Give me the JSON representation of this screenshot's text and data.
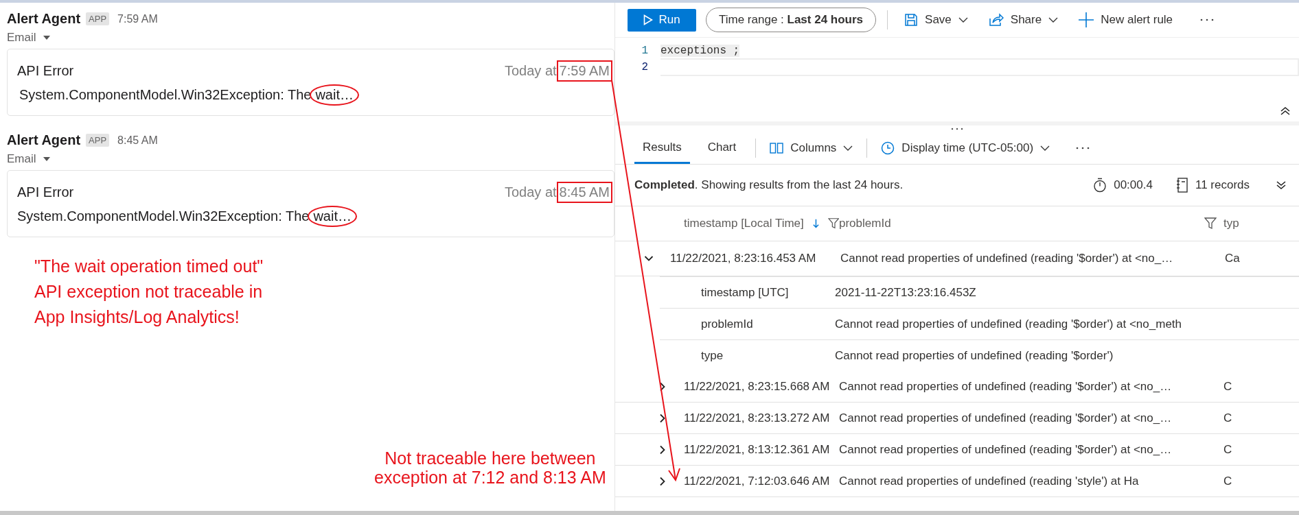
{
  "messages": [
    {
      "sender": "Alert Agent",
      "badge": "APP",
      "time": "7:59 AM",
      "channel": "Email",
      "card": {
        "title": "API Error",
        "prefix": "Today at",
        "time": "7:59 AM",
        "message": "System.ComponentModel.Win32Exception: The",
        "highlight": "wait…"
      }
    },
    {
      "sender": "Alert Agent",
      "badge": "APP",
      "time": "8:45 AM",
      "channel": "Email",
      "card": {
        "title": "API Error",
        "prefix": "Today at",
        "time": "8:45 AM",
        "message": "System.ComponentModel.Win32Exception: The",
        "highlight": "wait…"
      }
    }
  ],
  "annotation": "\"The wait operation timed out\" API exception not traceable in App Insights/Log Analytics!",
  "bottom_annotation": [
    "Not traceable here between",
    "exception at 7:12 and 8:13 AM"
  ],
  "toolbar": {
    "run": "Run",
    "time_range_label": "Time range :",
    "time_range_value": "Last 24 hours",
    "save": "Save",
    "share": "Share",
    "new_alert_rule": "New alert rule"
  },
  "editor": [
    {
      "number": "1",
      "code": "exceptions ;"
    },
    {
      "number": "2"
    }
  ],
  "tabs": [
    {
      "label": "Results",
      "selected": true
    },
    {
      "label": "Chart",
      "selected": false
    }
  ],
  "columns_button": "Columns",
  "display_time": "Display time (UTC-05:00)",
  "status": "**Completed**. Showing results from the last 24 hours.",
  "duration": "00:00.4",
  "records": "11 records",
  "table": {
    "columns": [
      "timestamp [Local Time]",
      "problemId",
      "typ"
    ],
    "rows": [
      {
        "expanded": true,
        "timestamp": "11/22/2021, 8:23:16.453 AM",
        "problemId": "Cannot read properties of undefined (reading '$order') at <no_…",
        "column_3": "Ca",
        "details": [
          {
            "key": "timestamp [UTC]",
            "value": "2021-11-22T13:23:16.453Z"
          },
          {
            "key": "problemId",
            "value": "Cannot read properties of undefined (reading '$order') at <no_meth"
          },
          {
            "key": "type",
            "value": "Cannot read properties of undefined (reading '$order')"
          }
        ]
      },
      {
        "expanded": false,
        "timestamp": "11/22/2021, 8:23:15.668 AM",
        "problemId": "Cannot read properties of undefined (reading '$order') at <no_…",
        "column_3": "C"
      },
      {
        "expanded": false,
        "timestamp": "11/22/2021, 8:23:13.272 AM",
        "problemId": "Cannot read properties of undefined (reading '$order') at <no_…",
        "column_3": "C"
      },
      {
        "expanded": false,
        "timestamp": "11/22/2021, 8:13:12.361 AM",
        "problemId": "Cannot read properties of undefined (reading '$order') at <no_…",
        "column_3": "C"
      },
      {
        "expanded": false,
        "timestamp": "11/22/2021, 7:12:03.646 AM",
        "problemId": "Cannot read properties of undefined (reading 'style') at Ha",
        "column_3": "C"
      }
    ]
  }
}
